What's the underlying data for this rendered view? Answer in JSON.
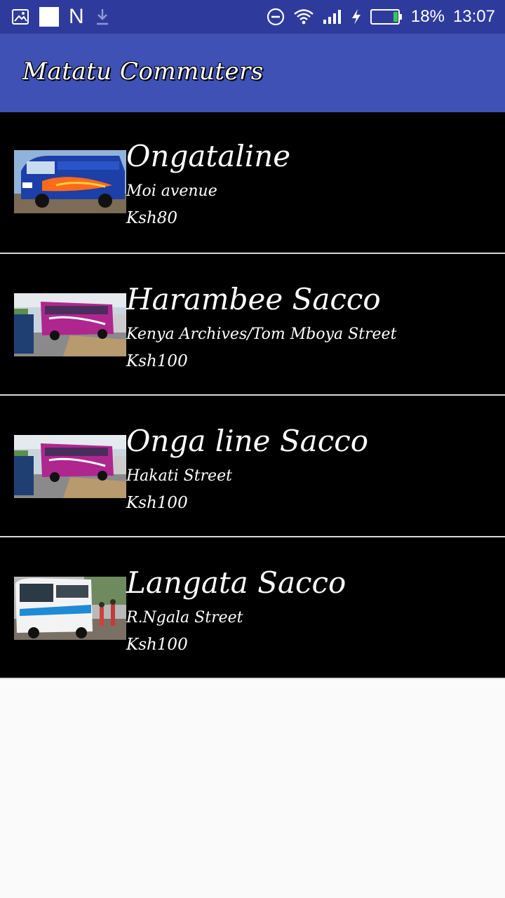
{
  "status_bar": {
    "battery": "18%",
    "time": "13:07",
    "notification_letter": "N",
    "icons": [
      "image-icon",
      "white-square-icon",
      "n-icon",
      "download-icon",
      "dnd-icon",
      "wifi-icon",
      "signal-icon",
      "charging-icon",
      "battery-icon"
    ]
  },
  "app_bar": {
    "title": "Matatu Commuters",
    "color": "#3f51b5"
  },
  "routes": [
    {
      "name": "Ongataline",
      "street": "Moi avenue",
      "fare": "Ksh80",
      "thumb": "matatu-blue"
    },
    {
      "name": "Harambee Sacco",
      "street": "Kenya Archives/Tom Mboya Street",
      "fare": "Ksh100",
      "thumb": "matatu-pink"
    },
    {
      "name": "Onga line Sacco",
      "street": "Hakati Street",
      "fare": "Ksh100",
      "thumb": "matatu-pink"
    },
    {
      "name": "Langata Sacco",
      "street": "R.Ngala Street",
      "fare": "Ksh100",
      "thumb": "bus-white"
    }
  ]
}
